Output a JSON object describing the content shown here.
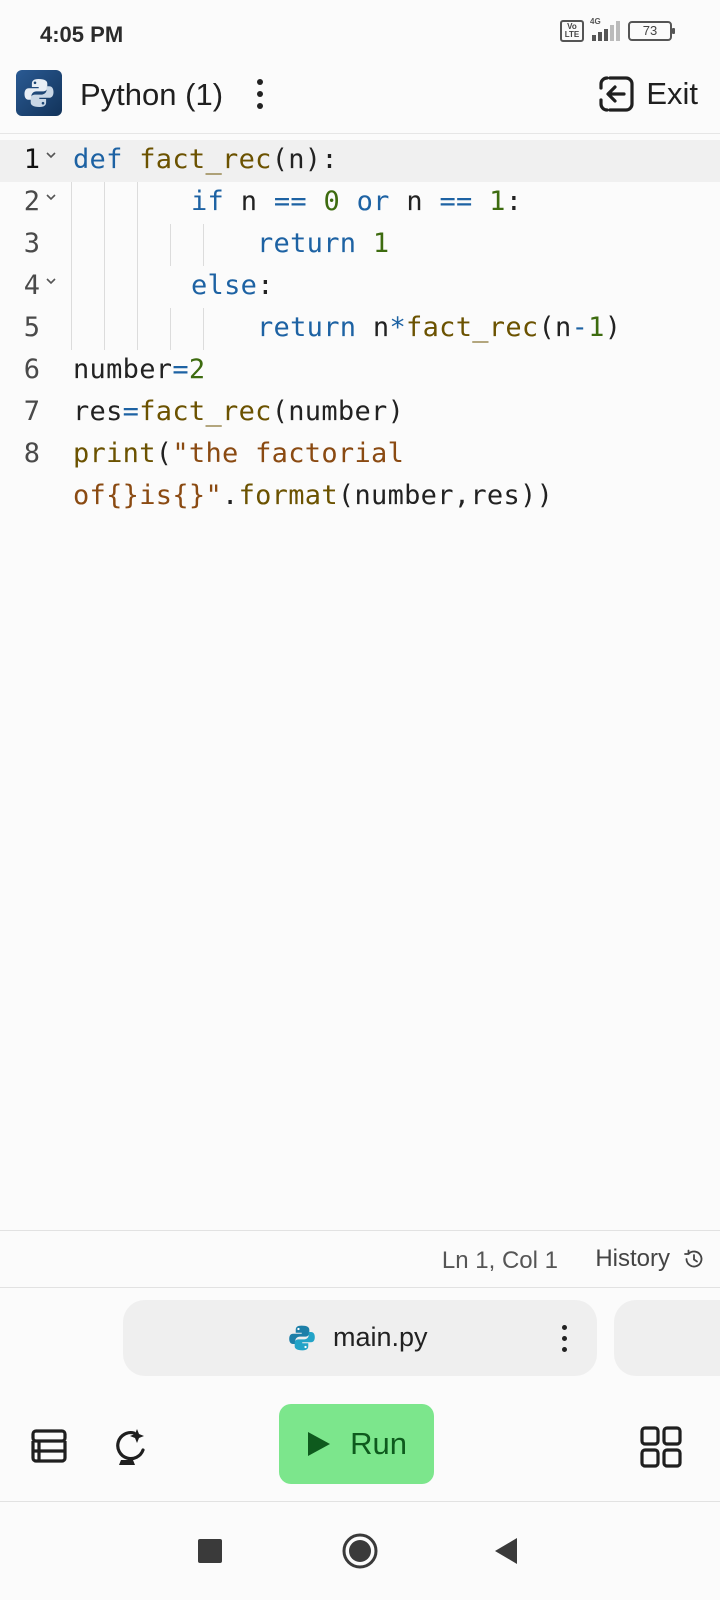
{
  "status_bar": {
    "time": "4:05 PM",
    "volte": "Vo LTE",
    "network": "4G",
    "battery": "73"
  },
  "header": {
    "title": "Python (1)",
    "exit_label": "Exit"
  },
  "editor": {
    "active_line": 1,
    "lines": [
      {
        "number": "1",
        "foldable": true
      },
      {
        "number": "2",
        "foldable": true
      },
      {
        "number": "3",
        "foldable": false
      },
      {
        "number": "4",
        "foldable": true
      },
      {
        "number": "5",
        "foldable": false
      },
      {
        "number": "6",
        "foldable": false
      },
      {
        "number": "7",
        "foldable": false
      },
      {
        "number": "8",
        "foldable": false
      }
    ],
    "code": [
      "def fact_rec(n):",
      "if n == 0 or n == 1:",
      "return 1",
      "else:",
      "return n*fact_rec(n-1)",
      "number=2",
      "res=fact_rec(number)",
      "print(\"the factorial",
      "of{}is{}\".format(number,res))"
    ],
    "tokens": {
      "l1": {
        "def": "def",
        "name": "fact_rec",
        "args": "(n):"
      },
      "l2": {
        "if": "if",
        "n1": "n",
        "eq1": "==",
        "zero": "0",
        "or": "or",
        "n2": "n",
        "eq2": "==",
        "one": "1",
        "colon": ":"
      },
      "l3": {
        "return": "return",
        "one": "1"
      },
      "l4": {
        "else": "else",
        "colon": ":"
      },
      "l5": {
        "return": "return",
        "n": "n",
        "star": "*",
        "call": "fact_rec",
        "lp": "(",
        "n2": "n",
        "minus": "-",
        "one": "1",
        "rp": ")"
      },
      "l6": {
        "name": "number",
        "eq": "=",
        "val": "2"
      },
      "l7": {
        "name": "res",
        "eq": "=",
        "call": "fact_rec",
        "args": "(number)"
      },
      "l8a": {
        "print": "print",
        "lp": "(",
        "str": "\"the factorial"
      },
      "l8b": {
        "str": "of{}is{}\"",
        "dot": ".",
        "format": "format",
        "args": "(number,res))"
      }
    }
  },
  "editor_status": {
    "cursor_position": "Ln 1, Col 1",
    "history_label": "History"
  },
  "file_tabs": [
    {
      "name": "main.py"
    }
  ],
  "toolbar": {
    "run_label": "Run"
  },
  "colors": {
    "keyword": "#1d62a3",
    "function": "#6b5200",
    "number": "#3d6b0f",
    "string": "#8a4a12",
    "run_button": "#7ce68c",
    "run_text": "#0e5a1d"
  },
  "icons": {
    "app": "python-logo-icon",
    "exit": "exit-icon",
    "history": "history-icon",
    "file": "python-file-icon",
    "toolbar": [
      "layers-icon",
      "ai-assistant-icon",
      "play-icon",
      "grid-icon"
    ],
    "nav": [
      "recents-square-icon",
      "home-circle-icon",
      "back-triangle-icon"
    ]
  }
}
